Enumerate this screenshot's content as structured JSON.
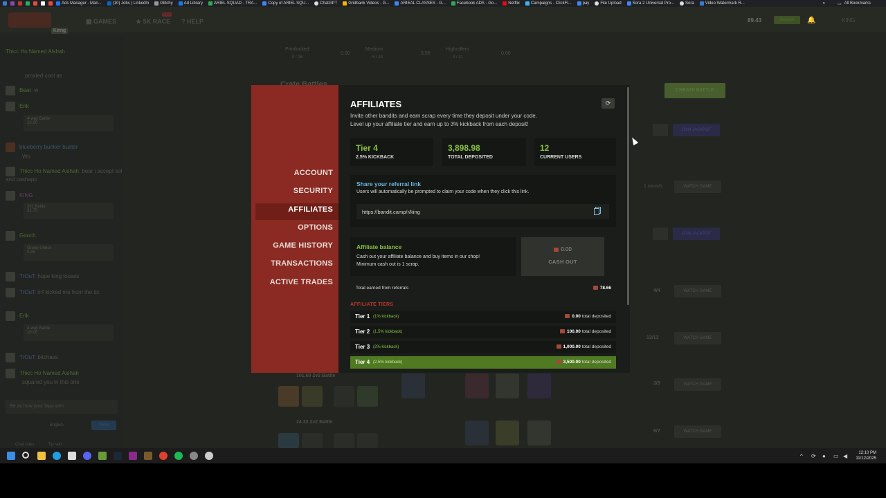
{
  "bookmarks": {
    "items": [
      "Ads Manager - Man...",
      "(10) Jobs | LinkedIn",
      "Glitchy",
      "Ad Library",
      "ARIEL SQUAD - TRA...",
      "Copy of ARIEL SQU...",
      "ChatGPT",
      "Gridbank Videos - G...",
      "ARIEAL CLASSES - G...",
      "Facebook ADS - Go...",
      "Netflix",
      "Campaigns - ClickFl...",
      "pay",
      "File Upload",
      "Sora 2 Universal Pro...",
      "Sora",
      "Video Watermark R..."
    ],
    "all_bookmarks": "All Bookmarks"
  },
  "site": {
    "nav": [
      "GAMES",
      "5K RACE",
      "HELP"
    ],
    "nav_badge": "New",
    "logo_tag": "Kinng",
    "balance": "89.43",
    "user": "KING",
    "deposit": "Deposit"
  },
  "chat": {
    "messages": [
      {
        "name": "Thicc Ho Named Aishah",
        "text": "proxied cool as"
      },
      {
        "name": "Bear",
        "text": "w"
      },
      {
        "name": "Erik",
        "text": ""
      },
      {
        "name": "blueberry bunker buster",
        "text": "Wo"
      },
      {
        "name": "Thicc Ho Named Aishah",
        "text": "bear i accept sol and cashapp"
      },
      {
        "name": "KING",
        "text": ""
      },
      {
        "name": "Gooch",
        "text": ""
      },
      {
        "name": "TrOuT",
        "text": "hope king looses"
      },
      {
        "name": "TrOuT",
        "text": "mf kicked me from the dc"
      },
      {
        "name": "Erik",
        "text": ""
      },
      {
        "name": "TrOuT",
        "text": "bitchass"
      },
      {
        "name": "Thicc Ho Named Aishah",
        "text": "squared you in this one"
      }
    ],
    "cards": [
      {
        "title": "4-way Battle",
        "value": "10.00"
      },
      {
        "title": "2v2 Battle",
        "value": "31.75"
      },
      {
        "title": "Group Unbox",
        "value": "0.35"
      },
      {
        "title": "4-way Battle",
        "value": "10.00"
      }
    ],
    "input_placeholder": "Be as how your tapa wen",
    "language": "English",
    "send": "Send",
    "footer_rules": "Chat rules",
    "footer_tip": "Tip rain"
  },
  "background": {
    "pools": [
      {
        "label": "Primlocked",
        "count": "0 / 16",
        "value": "0.00"
      },
      {
        "label": "Medium",
        "count": "6 / 24",
        "value": "5.56"
      },
      {
        "label": "Highrollers",
        "count": "0 / 11",
        "value": "0.00"
      }
    ],
    "heading": "Crate Battles",
    "create_battle": "CREATE BATTLE",
    "join_jackpot": "JOIN JACKPOT",
    "watch_game": "WATCH GAME",
    "rounds": [
      "1 rounds",
      "4/4",
      "13/13",
      "3/5",
      "6/7"
    ],
    "battle_values": [
      {
        "value": "101.60",
        "type": "2v2 Battle"
      },
      {
        "value": "24.33",
        "type": "2v2 Battle"
      }
    ]
  },
  "modal": {
    "sidebar": [
      "ACCOUNT",
      "SECURITY",
      "AFFILIATES",
      "OPTIONS",
      "GAME HISTORY",
      "TRANSACTIONS",
      "ACTIVE TRADES"
    ],
    "active": "AFFILIATES",
    "title": "AFFILIATES",
    "subtitle_line1": "Invite other bandits and earn scrap every time they deposit under your code.",
    "subtitle_line2": "Level up your affiliate tier and earn up to 3% kickback from each deposit!",
    "stats": [
      {
        "value": "Tier 4",
        "label": "2.5% KICKBACK"
      },
      {
        "value": "3,898.98",
        "label": "TOTAL DEPOSITED"
      },
      {
        "value": "12",
        "label": "CURRENT USERS"
      }
    ],
    "share": {
      "title": "Share your referral link",
      "subtitle": "Users will automatically be prompted to claim your code when they click this link.",
      "link": "https://bandit.camp/r/king"
    },
    "balance": {
      "title": "Affiliate balance",
      "line1": "Cash out your affiliate balance and buy items in our shop!",
      "line2": "Minimum cash out is 1 scrap.",
      "amount": "0.00",
      "cashout_label": "CASH OUT"
    },
    "earned": {
      "label": "Total earned from referrals",
      "value": "78.66"
    },
    "tiers_title": "AFFILIATE TIERS",
    "tiers": [
      {
        "name": "Tier 1",
        "kickback": "(1% kickback)",
        "amount": "0.00",
        "suffix": "total deposited"
      },
      {
        "name": "Tier 2",
        "kickback": "(1.5% kickback)",
        "amount": "100.00",
        "suffix": "total deposited"
      },
      {
        "name": "Tier 3",
        "kickback": "(2% kickback)",
        "amount": "1,000.00",
        "suffix": "total deposited"
      },
      {
        "name": "Tier 4",
        "kickback": "(2.5% kickback)",
        "amount": "3,500.00",
        "suffix": "total deposited"
      }
    ],
    "active_tier": "Tier 4"
  },
  "taskbar": {
    "time": "12:10 PM",
    "date": "11/12/2025"
  },
  "colors": {
    "accent_green": "#86c043",
    "sidebar_red": "#8a2a22",
    "tier_active": "#4f7a22",
    "link_blue": "#6bb7e0"
  }
}
